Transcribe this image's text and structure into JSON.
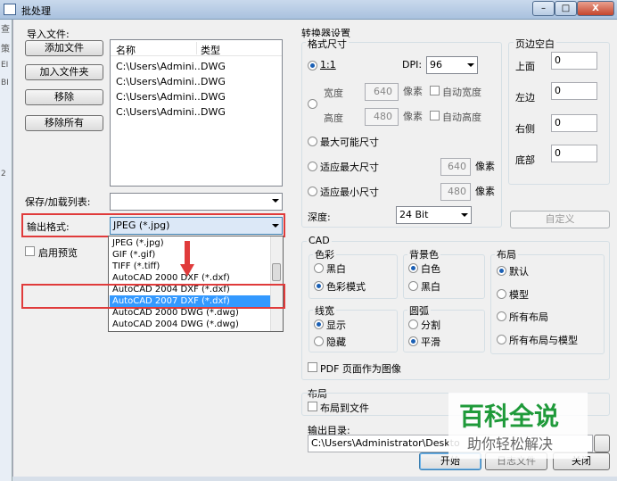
{
  "window": {
    "title": "批处理",
    "min": "–",
    "max": "□",
    "close": "X"
  },
  "left_strip": [
    "查",
    "策",
    "EI",
    "BI",
    "2",
    "",
    ""
  ],
  "import": {
    "label": "导入文件:",
    "buttons": {
      "add_file": "添加文件",
      "add_folder": "加入文件夹",
      "remove": "移除",
      "remove_all": "移除所有"
    },
    "columns": [
      "名称",
      "类型"
    ],
    "files": [
      {
        "name": "C:\\Users\\Admini...",
        "type": "DWG"
      },
      {
        "name": "C:\\Users\\Admini...",
        "type": "DWG"
      },
      {
        "name": "C:\\Users\\Admini...",
        "type": "DWG"
      },
      {
        "name": "C:\\Users\\Admini...",
        "type": "DWG"
      }
    ]
  },
  "save_list": {
    "label": "保存/加载列表:",
    "value": ""
  },
  "output_format": {
    "label": "输出格式:",
    "value": "JPEG (*.jpg)",
    "options": [
      "JPEG (*.jpg)",
      "GIF (*.gif)",
      "TIFF (*.tiff)",
      "AutoCAD 2000 DXF (*.dxf)",
      "AutoCAD 2004 DXF (*.dxf)",
      "AutoCAD 2007 DXF (*.dxf)",
      "AutoCAD 2000 DWG (*.dwg)",
      "AutoCAD 2004 DWG (*.dwg)"
    ],
    "highlighted": "AutoCAD 2007 DXF (*.dxf)"
  },
  "preview": {
    "label": "启用预览"
  },
  "converter": {
    "title": "转换器设置",
    "format_size": {
      "title": "格式尺寸",
      "ratio": "1:1",
      "dpi_label": "DPI:",
      "dpi_value": "96",
      "width_label": "宽度",
      "width_value": "640",
      "height_label": "高度",
      "height_value": "480",
      "pixel": "像素",
      "auto_width": "自动宽度",
      "auto_height": "自动高度",
      "max_size": "最大可能尺寸",
      "fit_max": "适应最大尺寸",
      "fit_max_value": "640",
      "fit_min": "适应最小尺寸",
      "fit_min_value": "480",
      "depth_label": "深度:",
      "depth_value": "24 Bit"
    },
    "margins": {
      "title": "页边空白",
      "top_label": "上面",
      "top": "0",
      "left_label": "左边",
      "left": "0",
      "right_label": "右侧",
      "right": "0",
      "bottom_label": "底部",
      "bottom": "0",
      "custom": "自定义"
    },
    "cad": {
      "title": "CAD",
      "color": {
        "title": "色彩",
        "black": "黑白",
        "color_mode": "色彩模式"
      },
      "background": {
        "title": "背景色",
        "white": "白色",
        "black": "黑白"
      },
      "layout": {
        "title": "布局",
        "default": "默认",
        "model": "模型",
        "all_layouts": "所有布局",
        "all_layouts_model": "所有布局与模型"
      },
      "lineweight": {
        "title": "线宽",
        "show": "显示",
        "hide": "隐藏"
      },
      "arc": {
        "title": "圆弧",
        "split": "分割",
        "smooth": "平滑"
      },
      "pdf_as_image": "PDF 页面作为图像"
    },
    "layout_section": {
      "title": "布局",
      "to_file": "布局到文件"
    },
    "output_dir": {
      "label": "输出目录:",
      "value": "C:\\Users\\Administrator\\Deskto"
    }
  },
  "actions": {
    "start": "开始",
    "log": "日志文件",
    "close": "关闭"
  },
  "watermark": {
    "main": "百科全说",
    "sub": "助你轻松解决"
  },
  "colors": {
    "highlight": "#3399ff",
    "red_box": "#e03b3b",
    "watermark_green": "#1f9a3a"
  }
}
